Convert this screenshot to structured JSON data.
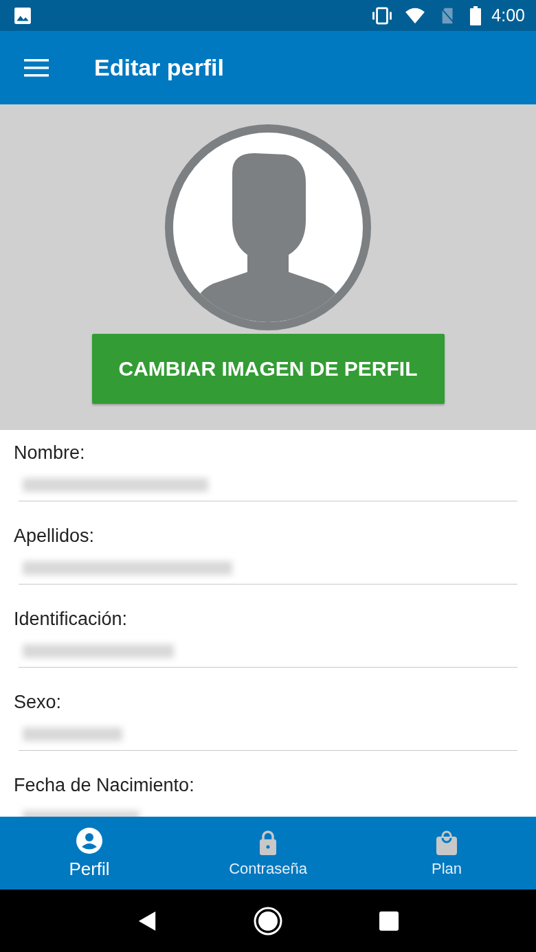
{
  "status_bar": {
    "time": "4:00"
  },
  "app_bar": {
    "title": "Editar perfil"
  },
  "profile": {
    "change_photo_button": "CAMBIAR IMAGEN DE PERFIL"
  },
  "fields": [
    {
      "label": "Nombre:",
      "blurred": true
    },
    {
      "label": "Apellidos:",
      "blurred": true
    },
    {
      "label": "Identificación:",
      "blurred": true
    },
    {
      "label": "Sexo:",
      "blurred": true
    },
    {
      "label": "Fecha de Nacimiento:",
      "blurred": true
    }
  ],
  "bottom_nav": [
    {
      "label": "Perfil",
      "kind": "person",
      "selected": true
    },
    {
      "label": "Contraseña",
      "kind": "lock",
      "selected": false
    },
    {
      "label": "Plan",
      "kind": "bag",
      "selected": false
    }
  ]
}
